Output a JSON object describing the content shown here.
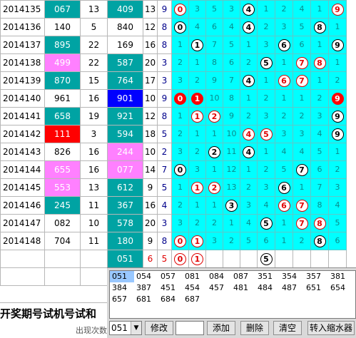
{
  "rows": [
    {
      "period": "2014135",
      "num": "067",
      "numColor": "teal",
      "span1": "13",
      "sum": "409",
      "sumColor": "teal",
      "s1": "13",
      "s2": "9",
      "digits": [
        {
          "v": "0",
          "b": "r"
        },
        {
          "v": "3"
        },
        {
          "v": "5"
        },
        {
          "v": "3"
        },
        {
          "v": "4",
          "b": "w"
        },
        {
          "v": "1"
        },
        {
          "v": "2"
        },
        {
          "v": "4"
        },
        {
          "v": "1"
        },
        {
          "v": "9",
          "b": "r"
        }
      ]
    },
    {
      "period": "2014136",
      "num": "140",
      "numColor": "white",
      "span1": "5",
      "sum": "840",
      "sumColor": "white",
      "s1": "12",
      "s2": "8",
      "digits": [
        {
          "v": "0",
          "b": "w"
        },
        {
          "v": "4"
        },
        {
          "v": "6"
        },
        {
          "v": "4"
        },
        {
          "v": "4",
          "b": "w"
        },
        {
          "v": "2"
        },
        {
          "v": "3"
        },
        {
          "v": "5"
        },
        {
          "v": "8",
          "b": "w"
        },
        {
          "v": "1"
        }
      ]
    },
    {
      "period": "2014137",
      "num": "895",
      "numColor": "teal",
      "span1": "22",
      "sum": "169",
      "sumColor": "white",
      "s1": "16",
      "s2": "8",
      "digits": [
        {
          "v": "1"
        },
        {
          "v": "1",
          "b": "w"
        },
        {
          "v": "7"
        },
        {
          "v": "5"
        },
        {
          "v": "1"
        },
        {
          "v": "3"
        },
        {
          "v": "6",
          "b": "w"
        },
        {
          "v": "6"
        },
        {
          "v": "1"
        },
        {
          "v": "9",
          "b": "w"
        }
      ]
    },
    {
      "period": "2014138",
      "num": "499",
      "numColor": "pink",
      "span1": "22",
      "sum": "587",
      "sumColor": "teal",
      "s1": "20",
      "s2": "3",
      "digits": [
        {
          "v": "2"
        },
        {
          "v": "1"
        },
        {
          "v": "8"
        },
        {
          "v": "6"
        },
        {
          "v": "2"
        },
        {
          "v": "5",
          "b": "w"
        },
        {
          "v": "1"
        },
        {
          "v": "7",
          "b": "r"
        },
        {
          "v": "8",
          "b": "r"
        },
        {
          "v": "1"
        }
      ]
    },
    {
      "period": "2014139",
      "num": "870",
      "numColor": "teal",
      "span1": "15",
      "sum": "764",
      "sumColor": "teal",
      "s1": "17",
      "s2": "3",
      "digits": [
        {
          "v": "3"
        },
        {
          "v": "2"
        },
        {
          "v": "9"
        },
        {
          "v": "7"
        },
        {
          "v": "4",
          "b": "w"
        },
        {
          "v": "1"
        },
        {
          "v": "6",
          "b": "r"
        },
        {
          "v": "7",
          "b": "r"
        },
        {
          "v": "1"
        },
        {
          "v": "2"
        }
      ]
    },
    {
      "period": "2014140",
      "num": "961",
      "numColor": "white",
      "span1": "16",
      "sum": "901",
      "sumColor": "blue",
      "s1": "10",
      "s2": "9",
      "digits": [
        {
          "v": "0",
          "b": "f"
        },
        {
          "v": "1",
          "b": "f"
        },
        {
          "v": "10"
        },
        {
          "v": "8"
        },
        {
          "v": "1"
        },
        {
          "v": "2"
        },
        {
          "v": "1"
        },
        {
          "v": "1"
        },
        {
          "v": "2"
        },
        {
          "v": "9",
          "b": "f"
        }
      ]
    },
    {
      "period": "2014141",
      "num": "658",
      "numColor": "teal",
      "span1": "19",
      "sum": "921",
      "sumColor": "teal",
      "s1": "12",
      "s2": "8",
      "digits": [
        {
          "v": "1"
        },
        {
          "v": "1",
          "b": "r"
        },
        {
          "v": "2",
          "b": "r"
        },
        {
          "v": "9"
        },
        {
          "v": "2"
        },
        {
          "v": "3"
        },
        {
          "v": "2"
        },
        {
          "v": "2"
        },
        {
          "v": "3"
        },
        {
          "v": "9",
          "b": "w"
        }
      ]
    },
    {
      "period": "2014142",
      "num": "111",
      "numColor": "red",
      "span1": "3",
      "sum": "594",
      "sumColor": "teal",
      "s1": "18",
      "s2": "5",
      "digits": [
        {
          "v": "2"
        },
        {
          "v": "1"
        },
        {
          "v": "1"
        },
        {
          "v": "10"
        },
        {
          "v": "4",
          "b": "r"
        },
        {
          "v": "5",
          "b": "r"
        },
        {
          "v": "3"
        },
        {
          "v": "3"
        },
        {
          "v": "4"
        },
        {
          "v": "9",
          "b": "w"
        }
      ]
    },
    {
      "period": "2014143",
      "num": "826",
      "numColor": "white",
      "span1": "16",
      "sum": "244",
      "sumColor": "pink",
      "s1": "10",
      "s2": "2",
      "digits": [
        {
          "v": "3"
        },
        {
          "v": "2"
        },
        {
          "v": "2",
          "b": "w"
        },
        {
          "v": "11"
        },
        {
          "v": "4",
          "b": "w"
        },
        {
          "v": "1"
        },
        {
          "v": "4"
        },
        {
          "v": "4"
        },
        {
          "v": "5"
        },
        {
          "v": "1"
        }
      ]
    },
    {
      "period": "2014144",
      "num": "655",
      "numColor": "pink",
      "span1": "16",
      "sum": "077",
      "sumColor": "pink",
      "s1": "14",
      "s2": "7",
      "digits": [
        {
          "v": "0",
          "b": "w"
        },
        {
          "v": "3"
        },
        {
          "v": "1"
        },
        {
          "v": "12"
        },
        {
          "v": "1"
        },
        {
          "v": "2"
        },
        {
          "v": "5"
        },
        {
          "v": "7",
          "b": "w"
        },
        {
          "v": "6"
        },
        {
          "v": "2"
        }
      ]
    },
    {
      "period": "2014145",
      "num": "553",
      "numColor": "pink",
      "span1": "13",
      "sum": "612",
      "sumColor": "teal",
      "s1": "9",
      "s2": "5",
      "digits": [
        {
          "v": "1"
        },
        {
          "v": "1",
          "b": "r"
        },
        {
          "v": "2",
          "b": "r"
        },
        {
          "v": "13"
        },
        {
          "v": "2"
        },
        {
          "v": "3"
        },
        {
          "v": "6",
          "b": "w"
        },
        {
          "v": "1"
        },
        {
          "v": "7"
        },
        {
          "v": "3"
        }
      ]
    },
    {
      "period": "2014146",
      "num": "245",
      "numColor": "teal",
      "span1": "11",
      "sum": "367",
      "sumColor": "teal",
      "s1": "16",
      "s2": "4",
      "digits": [
        {
          "v": "2"
        },
        {
          "v": "1"
        },
        {
          "v": "1"
        },
        {
          "v": "3",
          "b": "w"
        },
        {
          "v": "3"
        },
        {
          "v": "4"
        },
        {
          "v": "6",
          "b": "r"
        },
        {
          "v": "7",
          "b": "r"
        },
        {
          "v": "8"
        },
        {
          "v": "4"
        }
      ]
    },
    {
      "period": "2014147",
      "num": "082",
      "numColor": "white",
      "span1": "10",
      "sum": "578",
      "sumColor": "teal",
      "s1": "20",
      "s2": "3",
      "digits": [
        {
          "v": "3"
        },
        {
          "v": "2"
        },
        {
          "v": "2"
        },
        {
          "v": "1"
        },
        {
          "v": "4"
        },
        {
          "v": "5",
          "b": "w"
        },
        {
          "v": "1"
        },
        {
          "v": "7",
          "b": "r"
        },
        {
          "v": "8",
          "b": "r"
        },
        {
          "v": "5"
        }
      ]
    },
    {
      "period": "2014148",
      "num": "704",
      "numColor": "white",
      "span1": "11",
      "sum": "180",
      "sumColor": "teal",
      "s1": "9",
      "s2": "8",
      "digits": [
        {
          "v": "0",
          "b": "r"
        },
        {
          "v": "1",
          "b": "r"
        },
        {
          "v": "3"
        },
        {
          "v": "2"
        },
        {
          "v": "5"
        },
        {
          "v": "6"
        },
        {
          "v": "1"
        },
        {
          "v": "2"
        },
        {
          "v": "8",
          "b": "w"
        },
        {
          "v": "6"
        }
      ]
    }
  ],
  "pending": {
    "sum": "051",
    "s1": "6",
    "s2": "5",
    "digits": [
      {
        "v": "0",
        "b": "r"
      },
      {
        "v": "1",
        "b": "r"
      },
      {
        "v": ""
      },
      {
        "v": ""
      },
      {
        "v": ""
      },
      {
        "v": "5",
        "b": "w"
      },
      {
        "v": ""
      },
      {
        "v": ""
      },
      {
        "v": ""
      },
      {
        "v": ""
      }
    ]
  },
  "header": {
    "text": "开奖期号试机号试和",
    "subtext": "出现次数"
  },
  "list": {
    "selected": "051",
    "items": [
      "051",
      "054",
      "057",
      "081",
      "084",
      "087",
      "351",
      "354",
      "357",
      "381",
      "384",
      "387",
      "451",
      "454",
      "457",
      "481",
      "484",
      "487",
      "651",
      "654",
      "657",
      "681",
      "684",
      "687"
    ]
  },
  "controls": {
    "select_value": "051",
    "modify_label": "修改",
    "input_value": "",
    "add_label": "添加",
    "delete_label": "删除",
    "clear_label": "清空",
    "zoom_label": "转入缩水器"
  },
  "colors": {
    "teal": "#00a3a3",
    "pink": "#ff80ff",
    "red": "#ff0000",
    "blue": "#0000ff",
    "cyan": "#00ffff"
  }
}
